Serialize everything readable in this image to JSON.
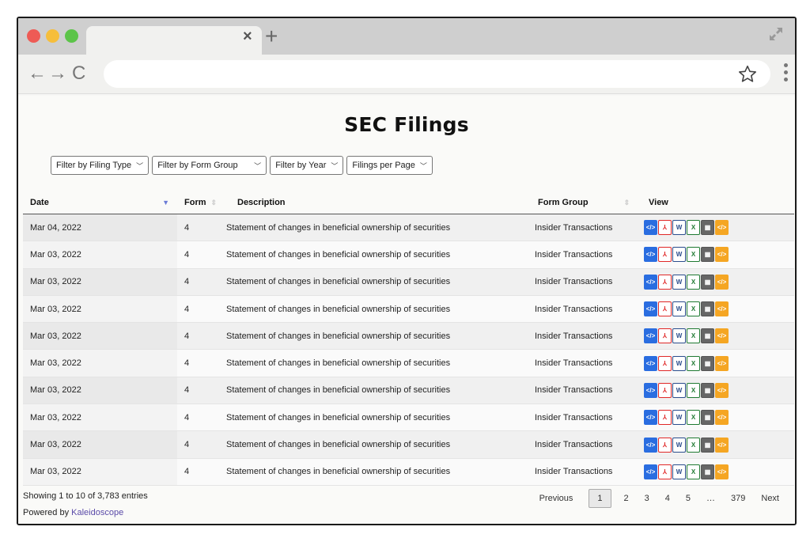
{
  "browser": {
    "tab_close": "×",
    "tab_new": "+",
    "nav_back": "←",
    "nav_forward": "→",
    "nav_reload": "C",
    "url": ""
  },
  "page": {
    "title": "SEC Filings"
  },
  "filters": [
    {
      "label": "Filter by Filing Type"
    },
    {
      "label": "Filter by Form Group"
    },
    {
      "label": "Filter by Year"
    },
    {
      "label": "Filings per Page"
    }
  ],
  "table": {
    "headers": {
      "date": "Date",
      "form": "Form",
      "description": "Description",
      "form_group": "Form Group",
      "view": "View"
    },
    "rows": [
      {
        "date": "Mar 04, 2022",
        "form": "4",
        "description": "Statement of changes in beneficial ownership of securities",
        "form_group": "Insider Transactions"
      },
      {
        "date": "Mar 03, 2022",
        "form": "4",
        "description": "Statement of changes in beneficial ownership of securities",
        "form_group": "Insider Transactions"
      },
      {
        "date": "Mar 03, 2022",
        "form": "4",
        "description": "Statement of changes in beneficial ownership of securities",
        "form_group": "Insider Transactions"
      },
      {
        "date": "Mar 03, 2022",
        "form": "4",
        "description": "Statement of changes in beneficial ownership of securities",
        "form_group": "Insider Transactions"
      },
      {
        "date": "Mar 03, 2022",
        "form": "4",
        "description": "Statement of changes in beneficial ownership of securities",
        "form_group": "Insider Transactions"
      },
      {
        "date": "Mar 03, 2022",
        "form": "4",
        "description": "Statement of changes in beneficial ownership of securities",
        "form_group": "Insider Transactions"
      },
      {
        "date": "Mar 03, 2022",
        "form": "4",
        "description": "Statement of changes in beneficial ownership of securities",
        "form_group": "Insider Transactions"
      },
      {
        "date": "Mar 03, 2022",
        "form": "4",
        "description": "Statement of changes in beneficial ownership of securities",
        "form_group": "Insider Transactions"
      },
      {
        "date": "Mar 03, 2022",
        "form": "4",
        "description": "Statement of changes in beneficial ownership of securities",
        "form_group": "Insider Transactions"
      },
      {
        "date": "Mar 03, 2022",
        "form": "4",
        "description": "Statement of changes in beneficial ownership of securities",
        "form_group": "Insider Transactions"
      }
    ],
    "view_icons": [
      "html-file-icon",
      "pdf-file-icon",
      "word-file-icon",
      "excel-file-icon",
      "xbrl-file-icon",
      "xml-file-icon"
    ]
  },
  "footer": {
    "entries_info": "Showing 1 to 10 of 3,783 entries",
    "powered_prefix": "Powered by ",
    "powered_link": "Kaleidoscope"
  },
  "pagination": {
    "previous": "Previous",
    "pages": [
      "1",
      "2",
      "3",
      "4",
      "5",
      "…",
      "379"
    ],
    "current": "1",
    "next": "Next"
  },
  "colors": {
    "html_icon": "#2a6de0",
    "pdf_icon": "#e02828",
    "word_icon": "#2b4d8c",
    "excel_icon": "#1f7a32",
    "xbrl_icon": "#666666",
    "xml_icon": "#f5a623",
    "link": "#5a4aa8"
  }
}
